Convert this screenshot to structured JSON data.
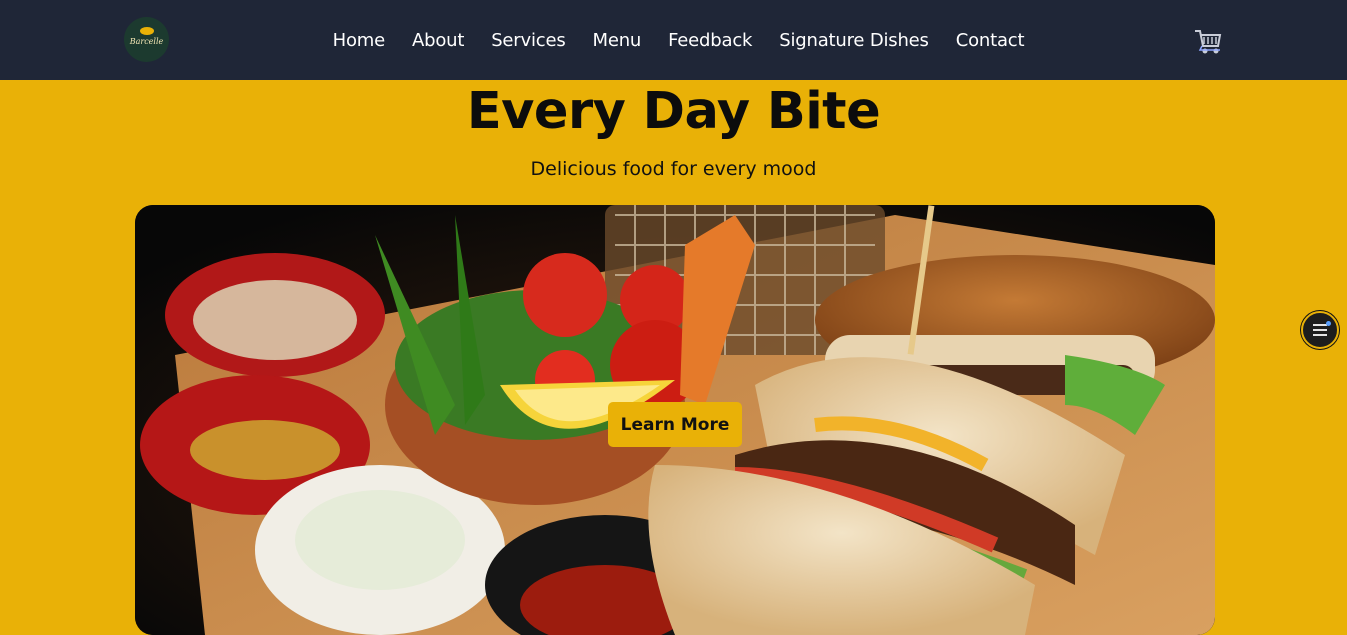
{
  "brand": {
    "logo_text": "Barcelle",
    "logo_color": "#e9b107",
    "icon": "restaurant-logo-icon"
  },
  "nav": {
    "items": [
      {
        "label": "Home"
      },
      {
        "label": "About"
      },
      {
        "label": "Services"
      },
      {
        "label": "Menu"
      },
      {
        "label": "Feedback"
      },
      {
        "label": "Signature Dishes"
      },
      {
        "label": "Contact"
      }
    ],
    "cart_icon": "shopping-cart-icon"
  },
  "hero": {
    "title": "Every Day Bite",
    "subtitle": "Delicious food for every mood",
    "cta_label": "Learn More",
    "image_icon": "burger-platter-image"
  },
  "floating_menu": {
    "icon": "hamburger-menu-icon",
    "has_notification": true
  },
  "colors": {
    "navbar_bg": "#1f2637",
    "accent": "#e9b107",
    "text_dark": "#0c0c0c"
  }
}
